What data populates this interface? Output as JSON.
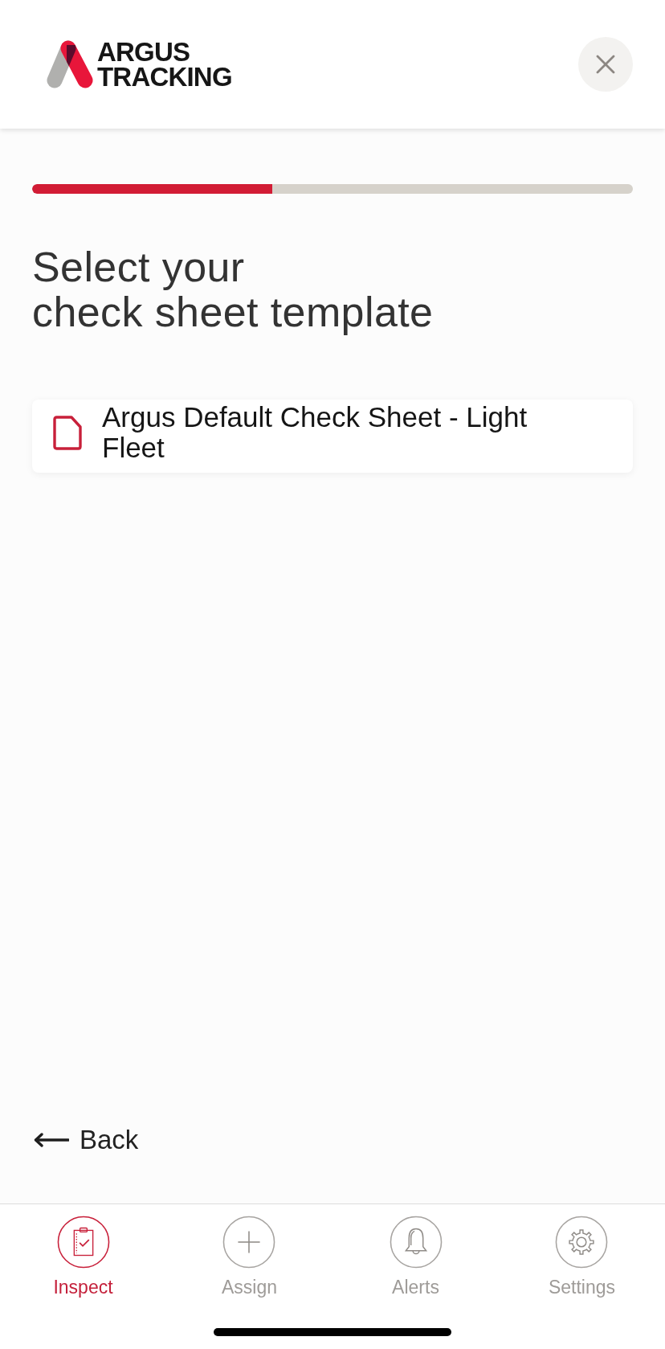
{
  "header": {
    "logo": {
      "lines": [
        "ARGUS",
        "TRACKING"
      ]
    }
  },
  "progress": {
    "level": 0.4
  },
  "title": "Select your\ncheck sheet template",
  "templates": [
    {
      "name": "Argus Default Check Sheet - Light Fleet"
    }
  ],
  "back_link": {
    "label": "Back"
  },
  "tabs": [
    {
      "label": "Inspect",
      "kind": "clipboard",
      "selected": true
    },
    {
      "label": "Assign",
      "kind": "plus",
      "selected": false
    },
    {
      "label": "Alerts",
      "kind": "bell",
      "selected": false
    },
    {
      "label": "Settings",
      "kind": "gear",
      "selected": false
    }
  ]
}
